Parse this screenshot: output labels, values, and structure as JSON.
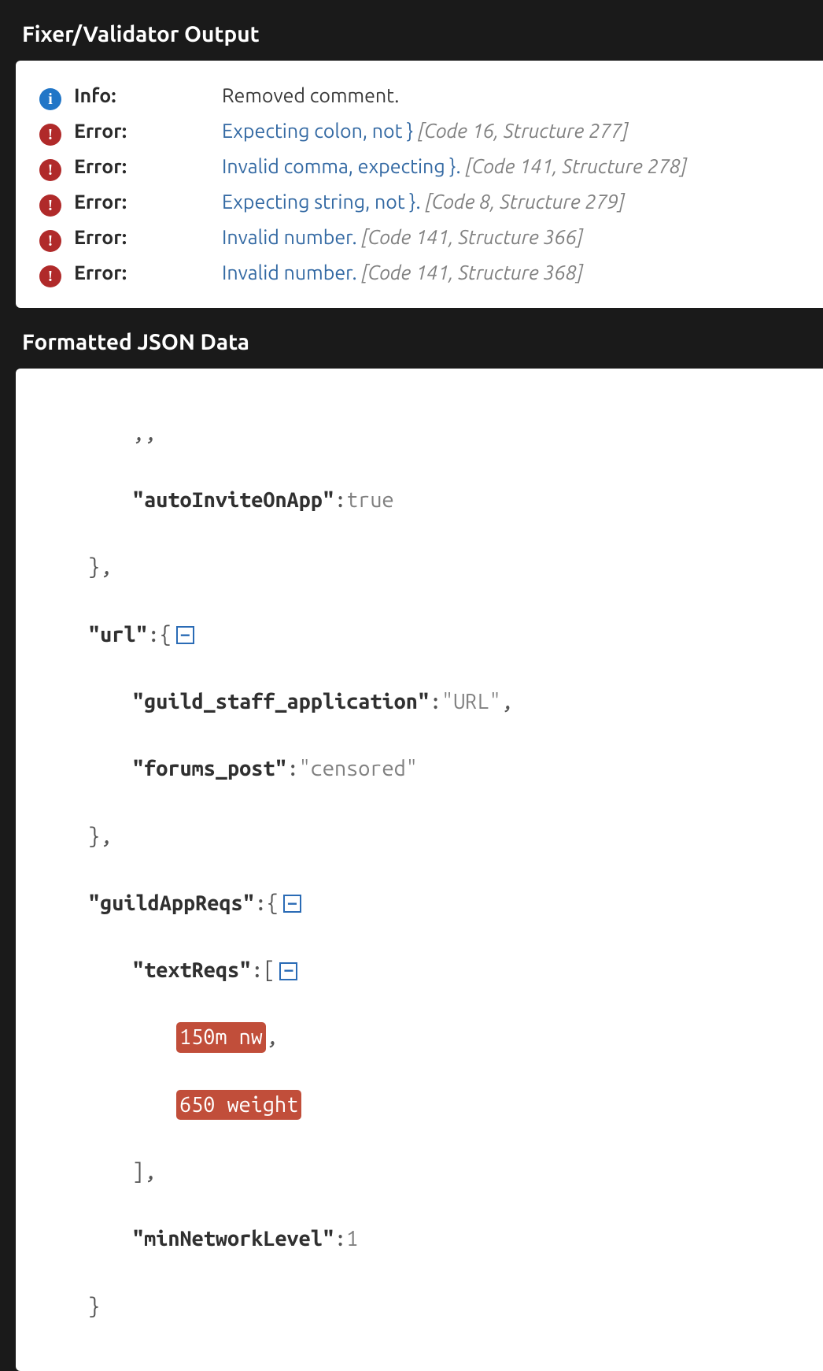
{
  "sections": {
    "validator_title": "Fixer/Validator Output",
    "json_title": "Formatted JSON Data"
  },
  "validator": {
    "rows": [
      {
        "type": "info",
        "label": "Info:",
        "message": "Removed comment.",
        "code_text": ""
      },
      {
        "type": "error",
        "label": "Error:",
        "message": "Expecting colon, not }",
        "code_text": "[Code 16, Structure 277]"
      },
      {
        "type": "error",
        "label": "Error:",
        "message": "Invalid comma, expecting }.",
        "code_text": "[Code 141, Structure 278]"
      },
      {
        "type": "error",
        "label": "Error:",
        "message": "Expecting string, not }.",
        "code_text": "[Code 8, Structure 279]"
      },
      {
        "type": "error",
        "label": "Error:",
        "message": "Invalid number.",
        "code_text": "[Code 141, Structure 366]"
      },
      {
        "type": "error",
        "label": "Error:",
        "message": "Invalid number.",
        "code_text": "[Code 141, Structure 368]"
      }
    ]
  },
  "json": {
    "line1_frag": ",,",
    "key_autoInvite": "\"autoInviteOnApp\"",
    "val_true": "true",
    "close_brace_comma": "},",
    "key_url": "\"url\"",
    "open_brace": ":{",
    "key_guild_staff": "\"guild_staff_application\"",
    "val_url": "\"URL\"",
    "key_forums": "\"forums_post\"",
    "val_censored": "\"censored\"",
    "key_guildAppReqs": "\"guildAppReqs\"",
    "key_textReqs": "\"textReqs\"",
    "open_bracket": ":[",
    "err_1": "150m nw",
    "err_2": "650 weight",
    "close_bracket_comma": "],",
    "key_minNetwork": "\"minNetworkLevel\"",
    "val_1": "1",
    "close_brace": "}",
    "toggle_glyph": "−"
  }
}
